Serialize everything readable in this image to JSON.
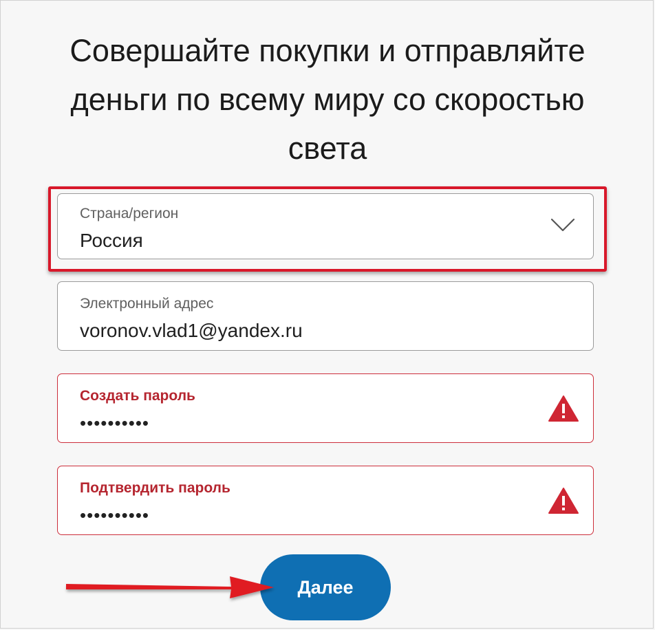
{
  "page": {
    "headline": "Совершайте покупки и отправляйте деньги по всему миру со скоростью света"
  },
  "form": {
    "country": {
      "label": "Страна/регион",
      "value": "Россия",
      "icon": "chevron-down-icon"
    },
    "email": {
      "label": "Электронный адрес",
      "value": "voronov.vlad1@yandex.ru"
    },
    "password": {
      "label": "Создать пароль",
      "value": "••••••••••",
      "icon": "warning-icon"
    },
    "confirm_password": {
      "label": "Подтвердить пароль",
      "value": "••••••••••",
      "icon": "warning-icon"
    },
    "next_label": "Далее"
  },
  "colors": {
    "accent": "#0f6fb3",
    "error": "#cc2d3a",
    "highlight": "#d8182a"
  }
}
